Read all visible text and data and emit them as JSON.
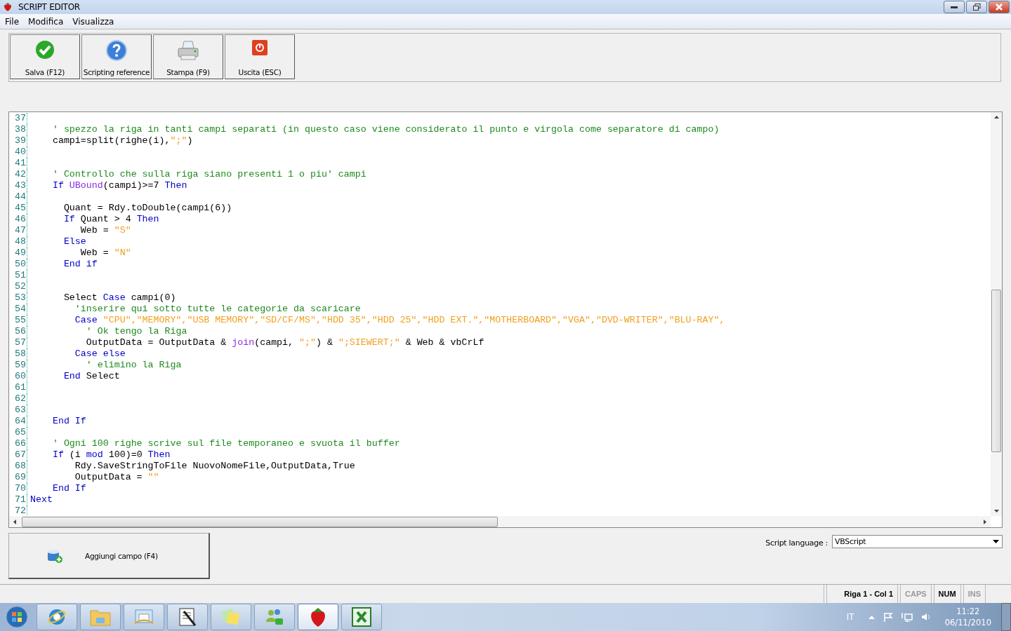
{
  "window": {
    "title": "SCRIPT EDITOR"
  },
  "menu": [
    {
      "label": "File"
    },
    {
      "label": "Modifica"
    },
    {
      "label": "Visualizza"
    }
  ],
  "toolbar": [
    {
      "label": "Salva (F12)",
      "kind": "check"
    },
    {
      "label": "Scripting reference",
      "kind": "help"
    },
    {
      "label": "Stampa (F9)",
      "kind": "printer"
    },
    {
      "label": "Uscita (ESC)",
      "kind": "power"
    }
  ],
  "editor": {
    "lines": [
      {
        "n": "37"
      },
      {
        "n": "38",
        "t": [
          {
            "kind": "comment",
            "s": "    ' spezzo la riga in tanti campi separati (in questo caso viene considerato il punto e virgola come separatore di campo)"
          }
        ]
      },
      {
        "n": "39",
        "t": [
          {
            "kind": "plain",
            "s": "    campi=split(righe(i),"
          },
          {
            "kind": "string",
            "s": "\";\""
          },
          {
            "kind": "plain",
            "s": ")"
          }
        ]
      },
      {
        "n": "40"
      },
      {
        "n": "41"
      },
      {
        "n": "42",
        "t": [
          {
            "kind": "comment",
            "s": "    ' Controllo che sulla riga siano presenti 1 o piu' campi"
          }
        ]
      },
      {
        "n": "43",
        "t": [
          {
            "kind": "keyword",
            "s": "    If "
          },
          {
            "kind": "function",
            "s": "UBound"
          },
          {
            "kind": "plain",
            "s": "(campi)>=7 "
          },
          {
            "kind": "keyword",
            "s": "Then"
          }
        ]
      },
      {
        "n": "44"
      },
      {
        "n": "45",
        "t": [
          {
            "kind": "plain",
            "s": "      Quant = Rdy.toDouble(campi(6))"
          }
        ]
      },
      {
        "n": "46",
        "t": [
          {
            "kind": "keyword",
            "s": "      If"
          },
          {
            "kind": "plain",
            "s": " Quant > 4 "
          },
          {
            "kind": "keyword",
            "s": "Then"
          }
        ]
      },
      {
        "n": "47",
        "t": [
          {
            "kind": "plain",
            "s": "         Web = "
          },
          {
            "kind": "string",
            "s": "\"S\""
          }
        ]
      },
      {
        "n": "48",
        "t": [
          {
            "kind": "keyword",
            "s": "      Else"
          }
        ]
      },
      {
        "n": "49",
        "t": [
          {
            "kind": "plain",
            "s": "         Web = "
          },
          {
            "kind": "string",
            "s": "\"N\""
          }
        ]
      },
      {
        "n": "50",
        "t": [
          {
            "kind": "keyword",
            "s": "      End if"
          }
        ]
      },
      {
        "n": "51"
      },
      {
        "n": "52"
      },
      {
        "n": "53",
        "t": [
          {
            "kind": "plain",
            "s": "      Select "
          },
          {
            "kind": "keyword",
            "s": "Case"
          },
          {
            "kind": "plain",
            "s": " campi(0)"
          }
        ]
      },
      {
        "n": "54",
        "t": [
          {
            "kind": "comment",
            "s": "        'inserire qui sotto tutte le categorie da scaricare"
          }
        ]
      },
      {
        "n": "55",
        "t": [
          {
            "kind": "keyword",
            "s": "        Case "
          },
          {
            "kind": "string",
            "s": "\"CPU\",\"MEMORY\",\"USB MEMORY\",\"SD/CF/MS\",\"HDD 35\",\"HDD 25\",\"HDD EXT.\",\"MOTHERBOARD\",\"VGA\",\"DVD-WRITER\",\"BLU-RAY\","
          }
        ]
      },
      {
        "n": "56",
        "t": [
          {
            "kind": "comment",
            "s": "          ' Ok tengo la Riga"
          }
        ]
      },
      {
        "n": "57",
        "t": [
          {
            "kind": "plain",
            "s": "          OutputData = OutputData & "
          },
          {
            "kind": "function",
            "s": "join"
          },
          {
            "kind": "plain",
            "s": "(campi, "
          },
          {
            "kind": "string",
            "s": "\";\""
          },
          {
            "kind": "plain",
            "s": ") & "
          },
          {
            "kind": "string",
            "s": "\";SIEWERT;\""
          },
          {
            "kind": "plain",
            "s": " & Web & vbCrLf"
          }
        ]
      },
      {
        "n": "58",
        "t": [
          {
            "kind": "keyword",
            "s": "        Case else"
          }
        ]
      },
      {
        "n": "59",
        "t": [
          {
            "kind": "comment",
            "s": "          ' elimino la Riga"
          }
        ]
      },
      {
        "n": "60",
        "t": [
          {
            "kind": "keyword",
            "s": "      End"
          },
          {
            "kind": "plain",
            "s": " Select"
          }
        ]
      },
      {
        "n": "61"
      },
      {
        "n": "62"
      },
      {
        "n": "63"
      },
      {
        "n": "64",
        "t": [
          {
            "kind": "keyword",
            "s": "    End If"
          }
        ]
      },
      {
        "n": "65"
      },
      {
        "n": "66",
        "t": [
          {
            "kind": "comment",
            "s": "    ' Ogni 100 righe scrive sul file temporaneo e svuota il buffer"
          }
        ]
      },
      {
        "n": "67",
        "t": [
          {
            "kind": "keyword",
            "s": "    If"
          },
          {
            "kind": "plain",
            "s": " (i "
          },
          {
            "kind": "keyword",
            "s": "mod"
          },
          {
            "kind": "plain",
            "s": " 100)=0 "
          },
          {
            "kind": "keyword",
            "s": "Then"
          }
        ]
      },
      {
        "n": "68",
        "t": [
          {
            "kind": "plain",
            "s": "        Rdy.SaveStringToFile NuovoNomeFile,OutputData,True"
          }
        ]
      },
      {
        "n": "69",
        "t": [
          {
            "kind": "plain",
            "s": "        OutputData = "
          },
          {
            "kind": "string",
            "s": "\"\""
          }
        ]
      },
      {
        "n": "70",
        "t": [
          {
            "kind": "keyword",
            "s": "    End If"
          }
        ]
      },
      {
        "n": "71",
        "t": [
          {
            "kind": "keyword",
            "s": "Next"
          }
        ]
      },
      {
        "n": "72"
      }
    ]
  },
  "add_field_button": {
    "label": "Aggiungi campo (F4)"
  },
  "script_language": {
    "label": "Script language :",
    "value": "VBScript"
  },
  "status_bar": [
    {
      "label": "Riga 1 - Col 1",
      "on": true
    },
    {
      "label": "CAPS",
      "on": false
    },
    {
      "label": "NUM",
      "on": true
    },
    {
      "label": "INS",
      "on": false
    }
  ],
  "taskbar": {
    "apps": [
      {
        "kind": "ie"
      },
      {
        "kind": "folder"
      },
      {
        "kind": "mail"
      },
      {
        "kind": "tool"
      },
      {
        "kind": "notes"
      },
      {
        "kind": "people"
      },
      {
        "kind": "berry",
        "selected": true
      },
      {
        "kind": "excel",
        "selected": false
      }
    ],
    "language": "IT",
    "time": "11:22",
    "date": "06/11/2010"
  }
}
